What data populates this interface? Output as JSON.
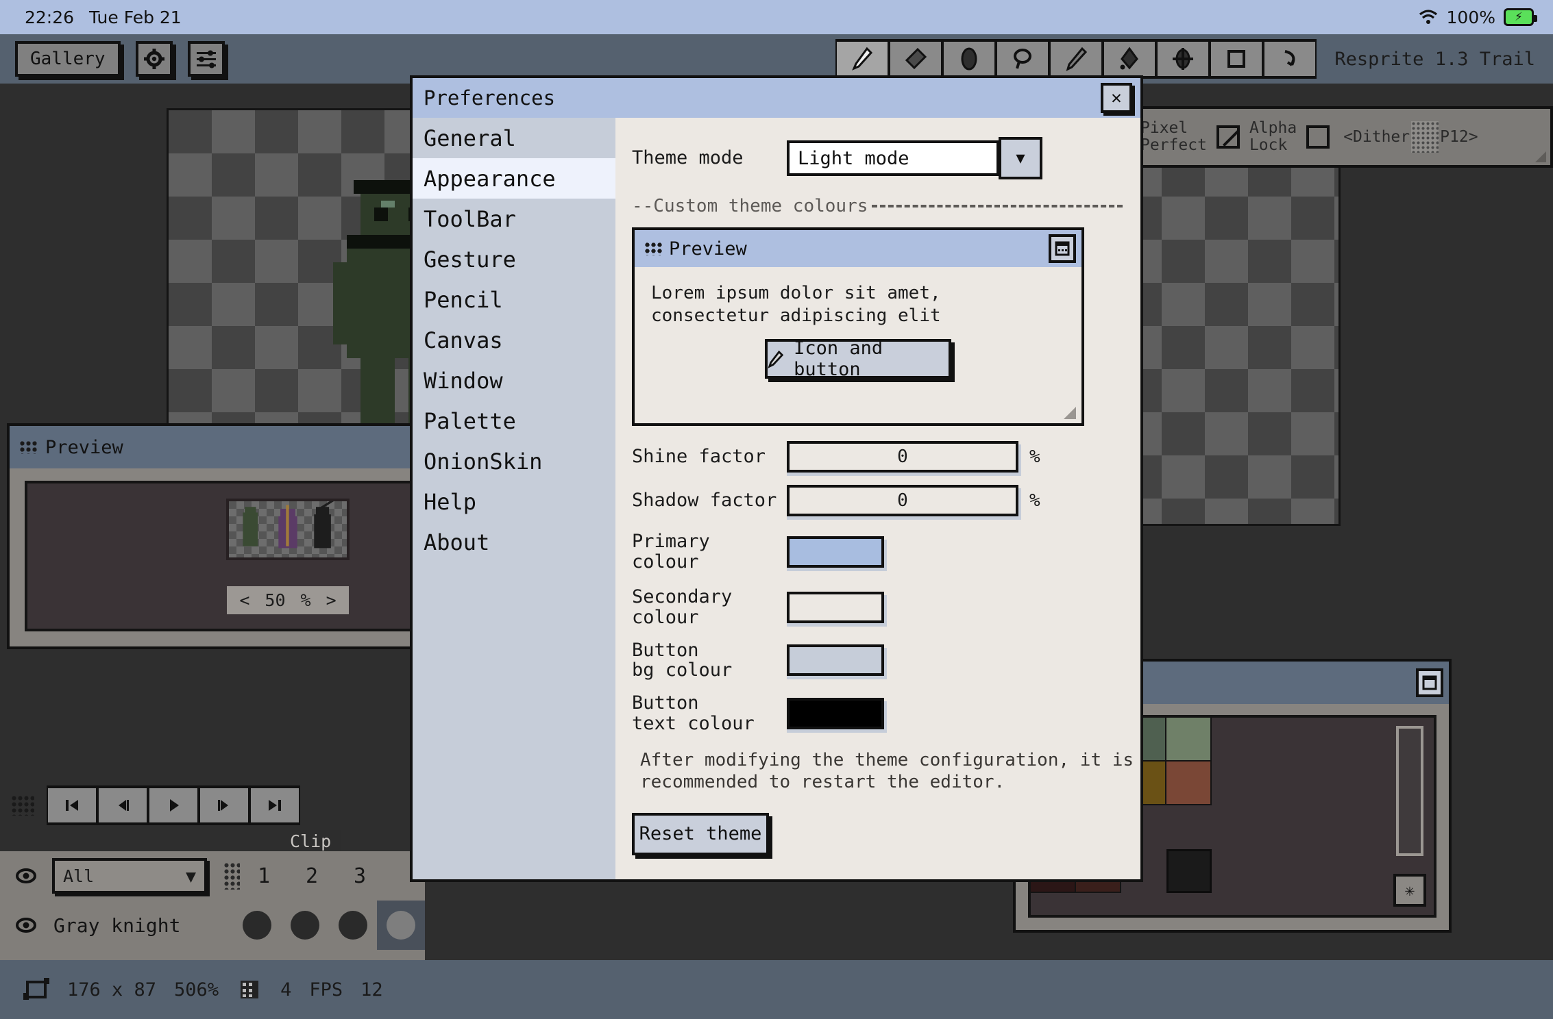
{
  "os_bar": {
    "time": "22:26",
    "date": "Tue Feb 21",
    "battery": "100%",
    "wifi_icon": "wifi-icon",
    "battery_icon": "battery-charging-icon"
  },
  "app": {
    "version_label": "Resprite 1.3 Trail",
    "gallery_label": "Gallery",
    "settings_icon": "gear-icon",
    "sliders_icon": "sliders-icon",
    "tools": [
      {
        "name": "pencil-tool",
        "icon": "pencil-icon",
        "active": true
      },
      {
        "name": "eraser-tool",
        "icon": "eraser-icon",
        "active": false
      },
      {
        "name": "blur-tool",
        "icon": "blur-icon",
        "active": false
      },
      {
        "name": "lasso-tool",
        "icon": "lasso-icon",
        "active": false
      },
      {
        "name": "brush-tool",
        "icon": "brush-icon",
        "active": false
      },
      {
        "name": "bucket-tool",
        "icon": "paint-bucket-icon",
        "active": false
      },
      {
        "name": "move-tool",
        "icon": "move-icon",
        "active": false
      },
      {
        "name": "select-rect-tool",
        "icon": "rectangle-icon",
        "active": false
      },
      {
        "name": "undo-tool",
        "icon": "undo-arrow-icon",
        "active": false
      }
    ]
  },
  "options_bar": {
    "pixel_perfect_label": "Pixel\nPerfect",
    "pixel_perfect_checked": true,
    "alpha_lock_label": "Alpha\nLock",
    "alpha_lock_checked": false,
    "dither_prev": "<",
    "dither_label": "Dither",
    "dither_value": "P12",
    "dither_next": ">"
  },
  "preview_window": {
    "title": "Preview",
    "grip_icon": "grid-dots-icon",
    "expand_icon": "grid-icon",
    "collapse_icon": "window-icon",
    "zoom_prev": "<",
    "zoom_value": "50",
    "zoom_unit": "%",
    "zoom_next": ">"
  },
  "playback": {
    "buttons": [
      {
        "name": "first-frame-button",
        "glyph": "|◀"
      },
      {
        "name": "prev-frame-button",
        "glyph": "◀|"
      },
      {
        "name": "play-button",
        "glyph": "▶"
      },
      {
        "name": "next-frame-button",
        "glyph": "|▶"
      },
      {
        "name": "last-frame-button",
        "glyph": "▶|"
      }
    ]
  },
  "timeline": {
    "clip_tab_label": "Clip",
    "layer_filter_value": "All",
    "frame_numbers": [
      "1",
      "2",
      "3"
    ],
    "layer_name": "Gray knight",
    "selected_frame": 4
  },
  "palette_window": {
    "title": "",
    "collapse_icon": "window-icon",
    "star_icon": "asterisk-icon",
    "colors": [
      "#3c4630",
      "#3c4c45",
      "#4f6050",
      "#6f8068",
      "",
      "",
      "#3a2519",
      "#3c2b53",
      "#6a5115",
      "#7a4736",
      "",
      "",
      "#4e4e4e",
      "#6e6e6e",
      "",
      "",
      "",
      "",
      "#2b1616",
      "#3a1f1b",
      "",
      "#1a1a1a",
      "",
      ""
    ]
  },
  "status_bar": {
    "canvas_icon": "canvas-size-icon",
    "dimensions": "176 x 87",
    "zoom": "506%",
    "frames_icon": "film-icon",
    "frame_count": "4",
    "fps_label": "FPS",
    "fps_value": "12"
  },
  "dialog": {
    "title": "Preferences",
    "close_icon": "close-icon",
    "nav": [
      {
        "label": "General",
        "selected": false
      },
      {
        "label": "Appearance",
        "selected": true
      },
      {
        "label": "ToolBar",
        "selected": false
      },
      {
        "label": "Gesture",
        "selected": false
      },
      {
        "label": "Pencil",
        "selected": false
      },
      {
        "label": "Canvas",
        "selected": false
      },
      {
        "label": "Window",
        "selected": false
      },
      {
        "label": "Palette",
        "selected": false
      },
      {
        "label": "OnionSkin",
        "selected": false
      },
      {
        "label": "Help",
        "selected": false
      },
      {
        "label": "About",
        "selected": false
      }
    ],
    "theme_mode_label": "Theme mode",
    "theme_mode_value": "Light mode",
    "dropdown_icon": "chevron-down-icon",
    "section_label": "--Custom theme colours",
    "preview": {
      "title": "Preview",
      "grip_icon": "grid-dots-icon",
      "collapse_icon": "window-icon",
      "lorem": "Lorem ipsum dolor sit amet, consectetur adipiscing elit",
      "button_label": "Icon and button",
      "button_icon": "pencil-icon"
    },
    "shine_label": "Shine factor",
    "shine_value": "0",
    "shine_unit": "%",
    "shadow_label": "Shadow factor",
    "shadow_value": "0",
    "shadow_unit": "%",
    "primary_label": "Primary colour",
    "primary_color": "#a8bde0",
    "secondary_label": "Secondary\ncolour",
    "secondary_color": "#ece8e3",
    "button_bg_label": "Button\nbg colour",
    "button_bg_color": "#c6cdd9",
    "button_text_label": "Button\ntext colour",
    "button_text_color": "#000000",
    "note": "After modifying the theme configuration, it is recommended to restart the editor.",
    "reset_label": "Reset theme"
  }
}
